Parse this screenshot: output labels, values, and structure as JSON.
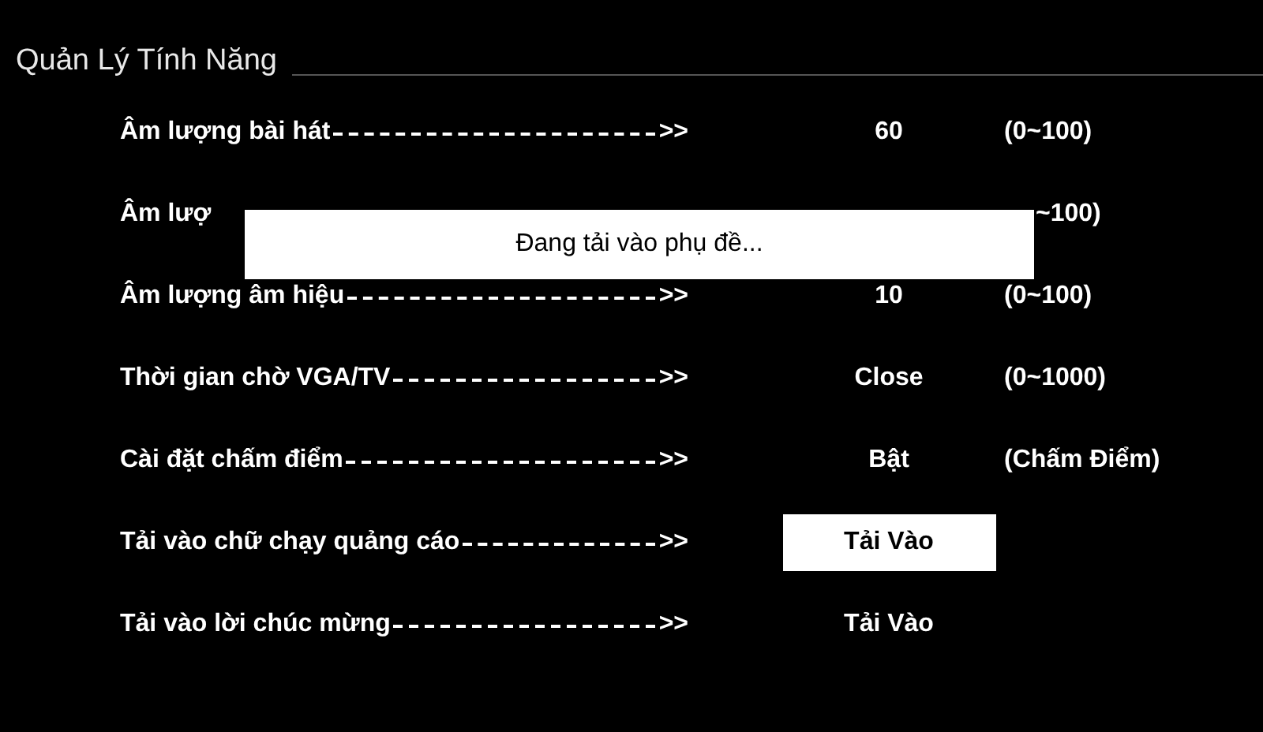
{
  "header": {
    "title": "Quản Lý Tính Năng"
  },
  "rows": [
    {
      "kind": "full",
      "label": "Âm lượng bài hát",
      "arrow": ">>",
      "value": "60",
      "range": "(0~100)",
      "selected": false
    },
    {
      "kind": "partial",
      "label": "Âm lượ",
      "range": "~100)"
    },
    {
      "kind": "full",
      "label": "Âm lượng âm hiệu",
      "arrow": ">>",
      "value": "10",
      "range": "(0~100)",
      "selected": false
    },
    {
      "kind": "full",
      "label": "Thời gian chờ VGA/TV",
      "arrow": ">>",
      "value": "Close",
      "range": "(0~1000)",
      "selected": false
    },
    {
      "kind": "full",
      "label": "Cài đặt chấm điểm",
      "arrow": ">>",
      "value": "Bật",
      "range": "(Chấm Điểm)",
      "selected": false
    },
    {
      "kind": "full",
      "label": "Tải vào chữ chạy quảng cáo",
      "arrow": ">>",
      "value": "Tải Vào",
      "selected": true
    },
    {
      "kind": "full",
      "label": "Tải vào lời chúc mừng",
      "arrow": ">>",
      "value": "Tải Vào",
      "selected": false
    }
  ],
  "dialog": {
    "message": "Đang tải vào phụ đề..."
  }
}
